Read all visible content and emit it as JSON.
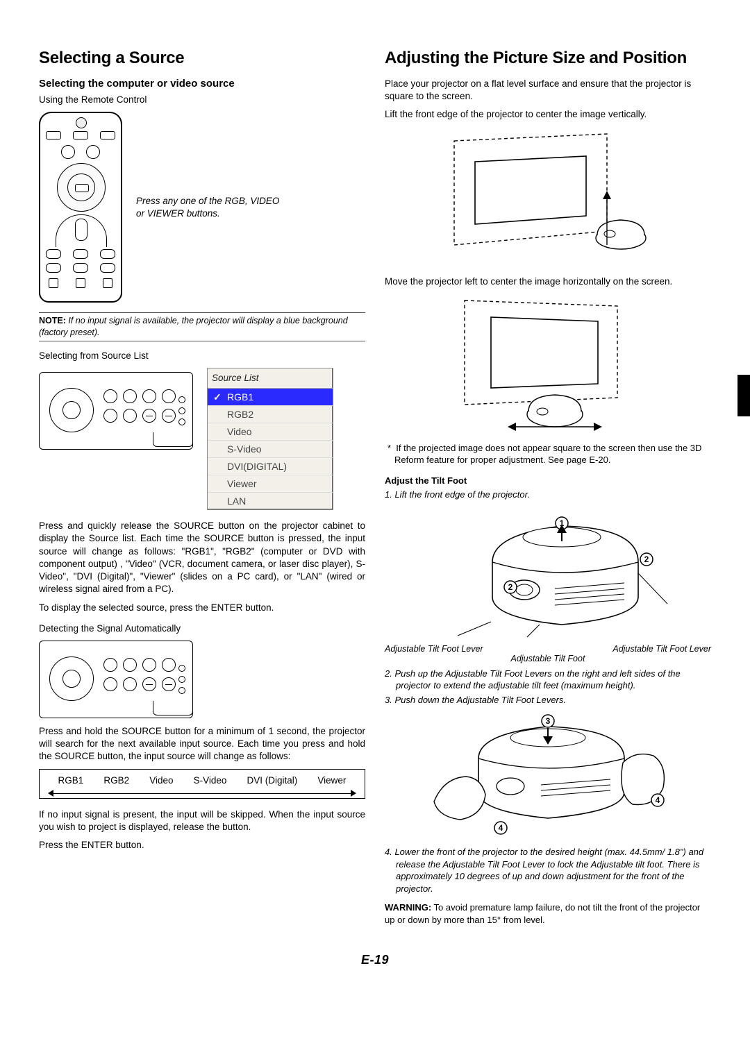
{
  "left": {
    "title": "Selecting a Source",
    "sub1": "Selecting the computer or video source",
    "using_remote": "Using the Remote Control",
    "press_hint": "Press any one of the RGB, VIDEO or VIEWER buttons.",
    "note_label": "NOTE:",
    "note_text": " If no input signal is available, the projector will display a blue background (factory preset).",
    "selecting_from": "Selecting from Source List",
    "source_list_title": "Source List",
    "sources": [
      "RGB1",
      "RGB2",
      "Video",
      "S-Video",
      "DVI(DIGITAL)",
      "Viewer",
      "LAN"
    ],
    "source_selected_index": 0,
    "para1": "Press and quickly release the SOURCE button on the projector cabinet to display the Source list. Each time the SOURCE button is pressed, the input source will change as follows: \"RGB1\", \"RGB2\" (computer or DVD with component output) , \"Video\" (VCR, document camera, or laser disc player), S-Video\", \"DVI (Digital)\", \"Viewer\" (slides on a PC card), or \"LAN\" (wired or wireless signal aired from a PC).",
    "para1b": "To display the selected source, press the ENTER button.",
    "detecting": "Detecting the Signal Automatically",
    "para2": "Press and hold the SOURCE button for a minimum of 1 second, the projector will search for the next available input source. Each time you press and hold the SOURCE button, the input source will change as follows:",
    "seq": [
      "RGB1",
      "RGB2",
      "Video",
      "S-Video",
      "DVI (Digital)",
      "Viewer"
    ],
    "para3": "If no input signal is present, the input will be skipped. When the input source you wish to project is displayed, release the button.",
    "para3b": "Press the ENTER button."
  },
  "right": {
    "title": "Adjusting the Picture Size and Position",
    "p1": "Place your projector on a flat level surface and ensure that the projector is square to the screen.",
    "p2": "Lift the front edge of the projector to center the image vertically.",
    "p3": "Move the projector left to center the image horizontally on the screen.",
    "foot_note": "If the projected image does not appear square to the screen then use the 3D Reform feature for proper adjustment. See page E-20.",
    "adjust_heading": "Adjust the Tilt Foot",
    "step1": "1. Lift the front edge of the projector.",
    "callouts": {
      "lever_r": "Adjustable Tilt Foot Lever",
      "lever_l": "Adjustable Tilt Foot Lever",
      "foot": "Adjustable Tilt Foot"
    },
    "step2": "2. Push up the Adjustable Tilt Foot Levers on the right and left sides of the projector to extend the adjustable tilt feet (maximum height).",
    "step3": "3. Push down the Adjustable Tilt Foot Levers.",
    "step4": "4. Lower the front of the projector to the desired height (max. 44.5mm/ 1.8\") and release the Adjustable Tilt Foot Lever to lock the Adjustable tilt foot. There is approximately 10 degrees of up and down adjustment for the front of the projector.",
    "warning_label": "WARNING:",
    "warning_text": " To avoid premature lamp failure, do not tilt the front of the projector up or down by more than 15° from level."
  },
  "page_num": "E-19"
}
